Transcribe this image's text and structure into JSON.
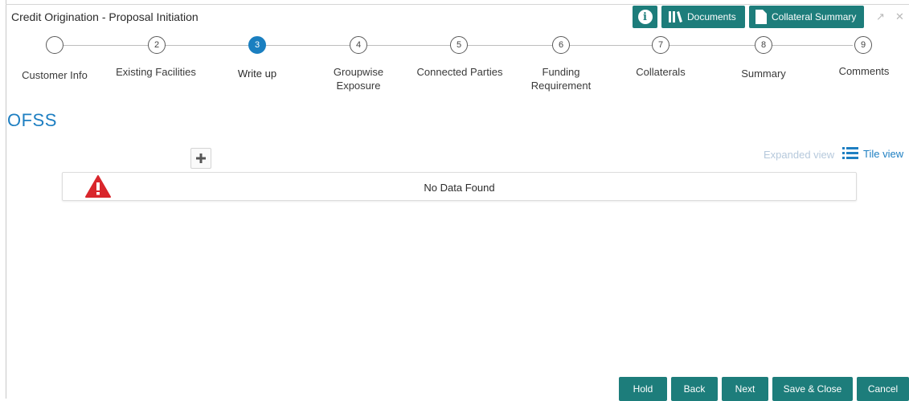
{
  "header": {
    "title": "Credit Origination - Proposal Initiation",
    "info_icon": "info-icon",
    "documents_label": "Documents",
    "collateral_summary_label": "Collateral Summary",
    "accent_color": "#1d7d7b"
  },
  "stepper": {
    "active_step": 3,
    "steps": [
      {
        "number": "",
        "label": "Customer Info"
      },
      {
        "number": "2",
        "label": "Existing Facilities"
      },
      {
        "number": "3",
        "label": "Write up"
      },
      {
        "number": "4",
        "label": "Groupwise Exposure"
      },
      {
        "number": "5",
        "label": "Connected Parties"
      },
      {
        "number": "6",
        "label": "Funding Requirement"
      },
      {
        "number": "7",
        "label": "Collaterals"
      },
      {
        "number": "8",
        "label": "Summary"
      },
      {
        "number": "9",
        "label": "Comments"
      }
    ]
  },
  "main": {
    "section_title": "OFSS",
    "view_toggle": {
      "expanded_label": "Expanded view",
      "tile_label": "Tile view",
      "selected": "Tile view"
    },
    "empty_message": "No Data Found"
  },
  "footer": {
    "hold": "Hold",
    "back": "Back",
    "next": "Next",
    "save_close": "Save & Close",
    "cancel": "Cancel"
  }
}
